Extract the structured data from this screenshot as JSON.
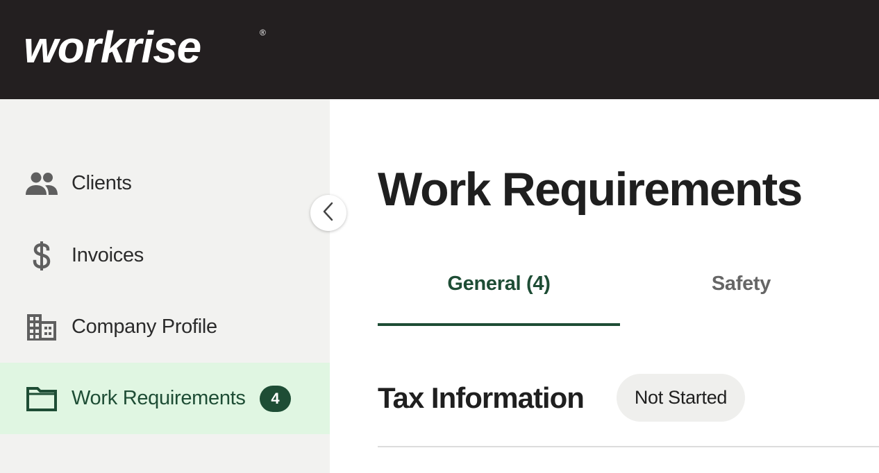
{
  "brand": {
    "logo_text": "workrise",
    "registered_mark": "®"
  },
  "sidebar": {
    "items": [
      {
        "label": "Clients",
        "icon": "people-icon"
      },
      {
        "label": "Invoices",
        "icon": "dollar-icon"
      },
      {
        "label": "Company Profile",
        "icon": "building-icon"
      },
      {
        "label": "Work Requirements",
        "icon": "folder-icon",
        "active": true,
        "badge": "4"
      }
    ]
  },
  "main": {
    "title": "Work Requirements",
    "tabs": [
      {
        "label": "General (4)",
        "active": true
      },
      {
        "label": "Safety",
        "active": false
      }
    ],
    "section": {
      "title": "Tax Information",
      "status": "Not Started"
    }
  },
  "colors": {
    "topbar": "#231f20",
    "accent": "#1e4d35",
    "active_bg": "#e0f6e2",
    "sidebar_bg": "#f2f2f0"
  }
}
